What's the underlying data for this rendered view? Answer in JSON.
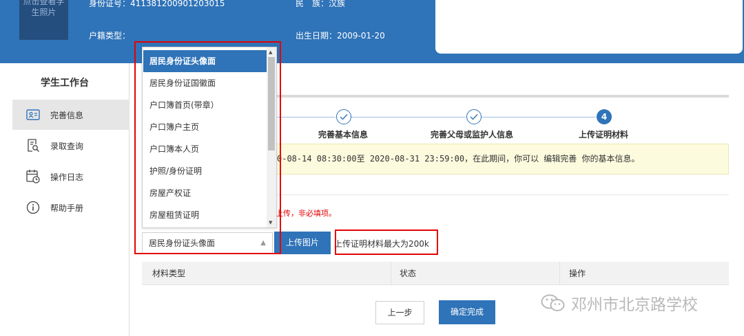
{
  "header": {
    "photo_text": "点击查看学生照片",
    "id_label": "身份证号：",
    "id_value": "411381200901203015",
    "nation_label": "民　族：",
    "nation_value": "汉族",
    "hukou_label": "户籍类型：",
    "hukou_value": "",
    "birth_label": "出生日期：",
    "birth_value": "2009-01-20"
  },
  "sidebar": {
    "title": "学生工作台",
    "items": [
      {
        "label": "完善信息",
        "icon": "id-card-icon",
        "active": true
      },
      {
        "label": "录取查询",
        "icon": "search-doc-icon",
        "active": false
      },
      {
        "label": "操作日志",
        "icon": "calendar-clock-icon",
        "active": false
      },
      {
        "label": "帮助手册",
        "icon": "info-icon",
        "active": false
      }
    ]
  },
  "steps": [
    {
      "label": "完善基本信息",
      "state": "done"
    },
    {
      "label": "完善父母或监护人信息",
      "state": "done"
    },
    {
      "label": "上传证明材料",
      "state": "current",
      "number": "4"
    }
  ],
  "notice": "0-08-14 08:30:00至 2020-08-31 23:59:00，在此期间，你可以 编辑完善 你的基本信息。",
  "red_note": "上传，非必填项。",
  "dropdown": {
    "options": [
      "居民身份证头像面",
      "居民身份证国徽面",
      "户口簿首页(带章）",
      "户口簿户主页",
      "户口簿本人页",
      "护照/身份证明",
      "房屋产权证",
      "房屋租赁证明"
    ],
    "selected": "居民身份证头像面"
  },
  "upload": {
    "button": "上传图片",
    "hint": "上传证明材料最大为200k"
  },
  "table": {
    "headers": [
      "材料类型",
      "状态",
      "操作"
    ]
  },
  "buttons": {
    "prev": "上一步",
    "finish": "确定完成"
  },
  "watermark": "邓州市北京路学校",
  "colors": {
    "brand_blue": "#2f73b8",
    "highlight_red": "#e60000",
    "notice_bg": "#fcfbde"
  }
}
